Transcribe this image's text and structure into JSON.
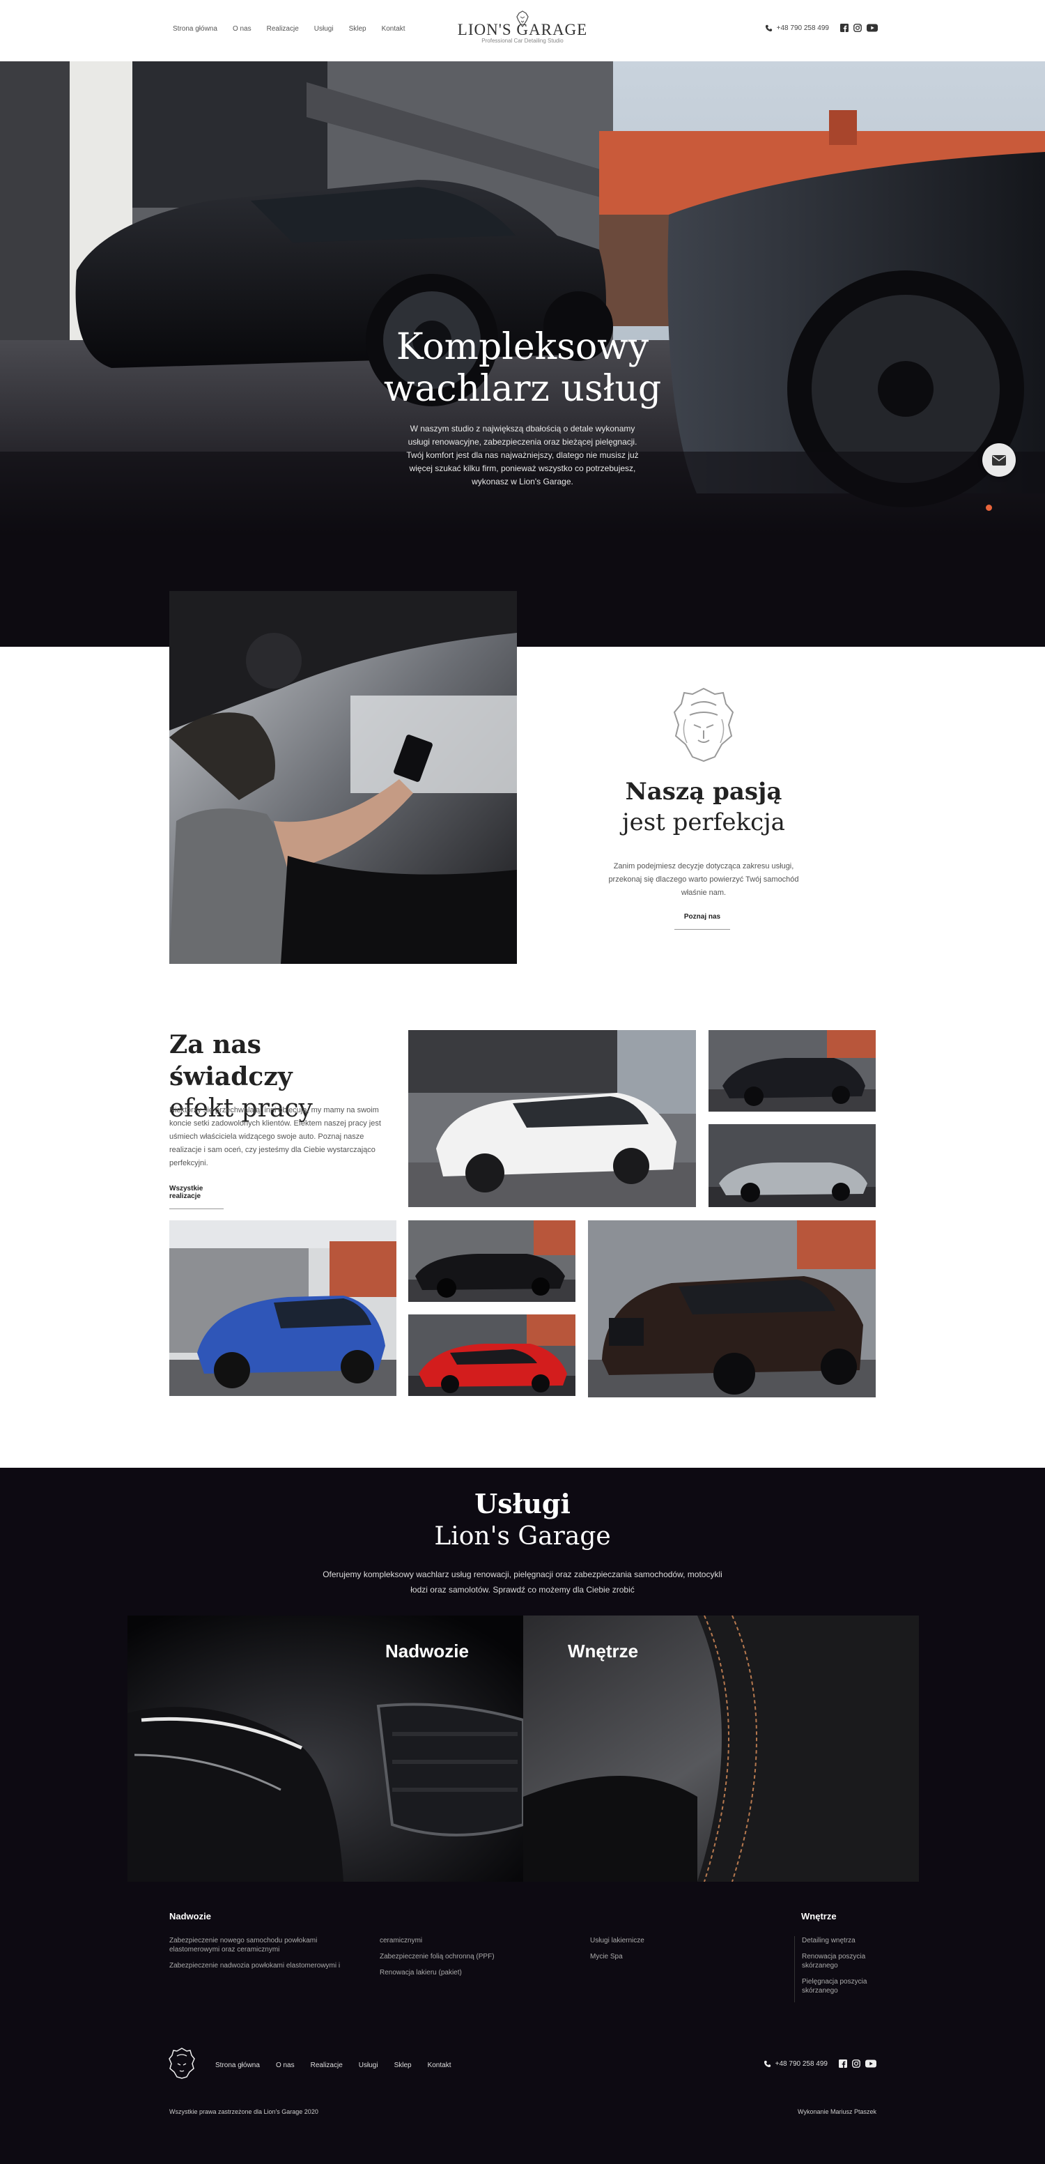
{
  "header": {
    "nav": [
      "Strona główna",
      "O nas",
      "Realizacje",
      "Usługi",
      "Sklep",
      "Kontakt"
    ],
    "logo_title": "LION'S GARAGE",
    "logo_subtitle": "Professional Car Detailing Studio",
    "phone": "+48 790 258 499",
    "social_icons": [
      "facebook-icon",
      "instagram-icon",
      "youtube-icon"
    ]
  },
  "hero": {
    "title_line1": "Kompleksowy",
    "title_line2": "wachlarz usług",
    "description": "W naszym studio z największą dbałością o detale wykonamy usługi renowacyjne, zabezpieczenia oraz bieżącej pielęgnacji. Twój komfort jest dla nas najważniejszy, dlatego nie musisz już więcej szukać kilku firm, ponieważ wszystko co potrzebujesz, wykonasz w Lion's Garage."
  },
  "about": {
    "title_line1": "Naszą pasją",
    "title_line2": "jest perfekcja",
    "description": "Zanim podejmiesz decyzje dotycząca zakresu usługi, przekonaj się dlaczego warto powierzyć Twój samochód właśnie nam.",
    "link": "Poznaj nas"
  },
  "portfolio": {
    "title_line1": "Za nas świadczy",
    "title_line2": "efekt pracy",
    "description": "Niektórzy się przechwalają, inni obiecują, my mamy na swoim koncie setki zadowolonych klientów. Efektem naszej pracy jest uśmiech właściciela widzącego swoje auto. Poznaj nasze realizacje i sam oceń, czy jesteśmy dla Ciebie wystarczająco perfekcyjni.",
    "link": "Wszystkie realizacje"
  },
  "services": {
    "title_line1": "Usługi",
    "title_line2": "Lion's Garage",
    "description": "Oferujemy kompleksowy wachlarz usług renowacji, pielęgnacji oraz zabezpieczania samochodów, motocykli łodzi oraz samolotów. Sprawdź co możemy dla Ciebie zrobić",
    "cards": [
      "Nadwozie",
      "Wnętrze"
    ],
    "list_heads": [
      "Nadwozie",
      "Wnętrze"
    ],
    "col1": [
      "Zabezpieczenie nowego samochodu powłokami elastomerowymi oraz ceramicznymi",
      "Zabezpieczenie nadwozia powłokami elastomerowymi i"
    ],
    "col2": [
      "ceramicznymi",
      "Zabezpieczenie folią ochronną (PPF)",
      "Renowacja lakieru (pakiet)"
    ],
    "col3": [
      "Usługi lakiernicze",
      "Mycie Spa"
    ],
    "col4": [
      "Detailing wnętrza",
      "Renowacja poszycia skórzanego",
      "Pielęgnacja poszycia skórzanego"
    ]
  },
  "footer": {
    "nav": [
      "Strona główna",
      "O nas",
      "Realizacje",
      "Usługi",
      "Sklep",
      "Kontakt"
    ],
    "phone": "+48 790 258 499",
    "copyright": "Wszystkie prawa zastrzeżone dla Lion's Garage 2020",
    "credit": "Wykonanie Mariusz Ptaszek"
  },
  "colors": {
    "accent": "#e8643b",
    "dark_bg": "#0d0a12"
  }
}
